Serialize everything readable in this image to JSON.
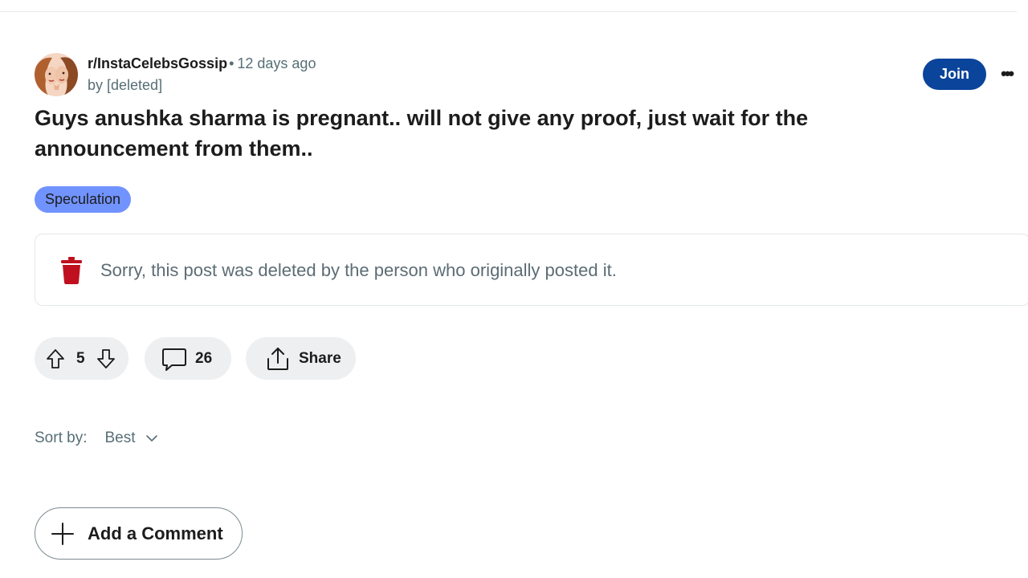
{
  "post": {
    "subreddit": "r/InstaCelebsGossip",
    "separator": "•",
    "time_ago": "12 days ago",
    "author": "by [deleted]",
    "join_label": "Join",
    "more_label": "•••",
    "title": "Guys anushka sharma is pregnant.. will not give any proof, just wait for the announcement from them..",
    "flair": "Speculation",
    "flair_color": "#7193ff",
    "deleted_message": "Sorry, this post was deleted by the person who originally posted it."
  },
  "actions": {
    "upvote_icon": "upvote-icon",
    "downvote_icon": "downvote-icon",
    "vote_count": "5",
    "comment_icon": "comment-icon",
    "comment_count": "26",
    "share_icon": "share-icon",
    "share_label": "Share"
  },
  "comments": {
    "sort_label": "Sort by:",
    "sort_value": "Best",
    "add_comment_label": "Add a Comment"
  },
  "colors": {
    "join_button": "#0a449b",
    "trash_icon": "#c0101f",
    "pill_bg": "#edeff1"
  }
}
